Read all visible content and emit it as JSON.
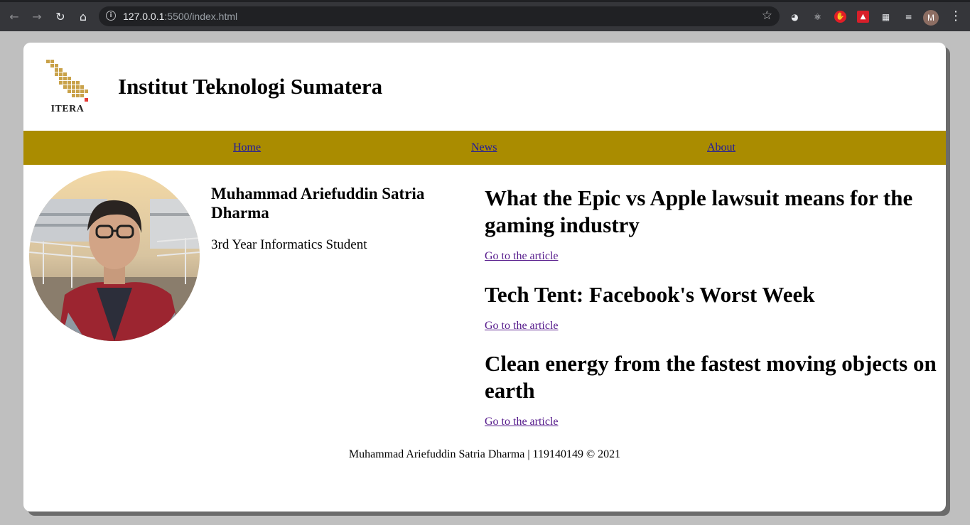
{
  "browser": {
    "url_host": "127.0.0.1",
    "url_rest": ":5500/index.html",
    "avatar_letter": "M",
    "icons": [
      "back-arrow-icon",
      "forward-arrow-icon",
      "reload-icon",
      "home-icon",
      "info-icon",
      "star-icon",
      "extension-icons",
      "puzzle-icon",
      "reading-list-icon",
      "menu-icon"
    ]
  },
  "header": {
    "logo_text": "ITERA",
    "title": "Institut Teknologi Sumatera",
    "logo_colors": {
      "tiles": "#c9a24a",
      "accent": "#e53935"
    }
  },
  "nav": {
    "items": [
      {
        "label": "Home"
      },
      {
        "label": "News"
      },
      {
        "label": "About"
      }
    ],
    "bg_color": "#aa8c00"
  },
  "profile": {
    "name": "Muhammad Ariefuddin Satria Dharma",
    "role": "3rd Year Informatics Student"
  },
  "articles": [
    {
      "title": "What the Epic vs Apple lawsuit means for the gaming industry",
      "link": "Go to the article"
    },
    {
      "title": "Tech Tent: Facebook's Worst Week",
      "link": "Go to the article"
    },
    {
      "title": "Clean energy from the fastest moving objects on earth",
      "link": "Go to the article"
    }
  ],
  "footer": {
    "text": "Muhammad Ariefuddin Satria Dharma | 119140149 © 2021"
  }
}
